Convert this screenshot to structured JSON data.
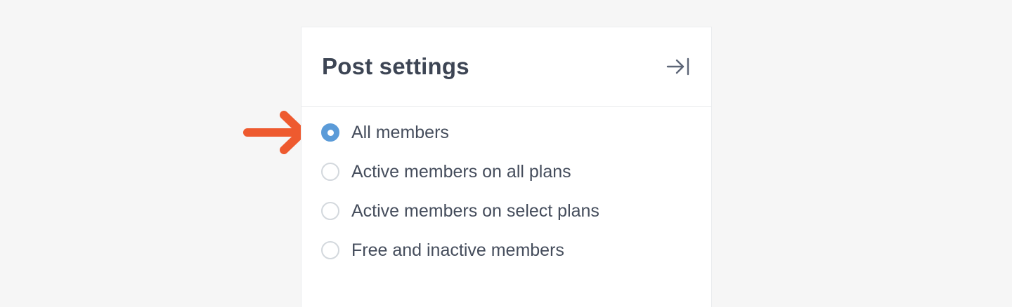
{
  "panel": {
    "title": "Post settings",
    "collapse_icon": "collapse-right-icon"
  },
  "visibility_options": [
    {
      "label": "All members",
      "checked": true
    },
    {
      "label": "Active members on all plans",
      "checked": false
    },
    {
      "label": "Active members on select plans",
      "checked": false
    },
    {
      "label": "Free and inactive members",
      "checked": false
    }
  ],
  "annotation": {
    "icon": "arrow-right-icon",
    "color": "#ee5a2f"
  },
  "colors": {
    "accent": "#5b9bd8",
    "title_text": "#3d4554",
    "label_text": "#454d5c",
    "background": "#f6f6f6"
  }
}
